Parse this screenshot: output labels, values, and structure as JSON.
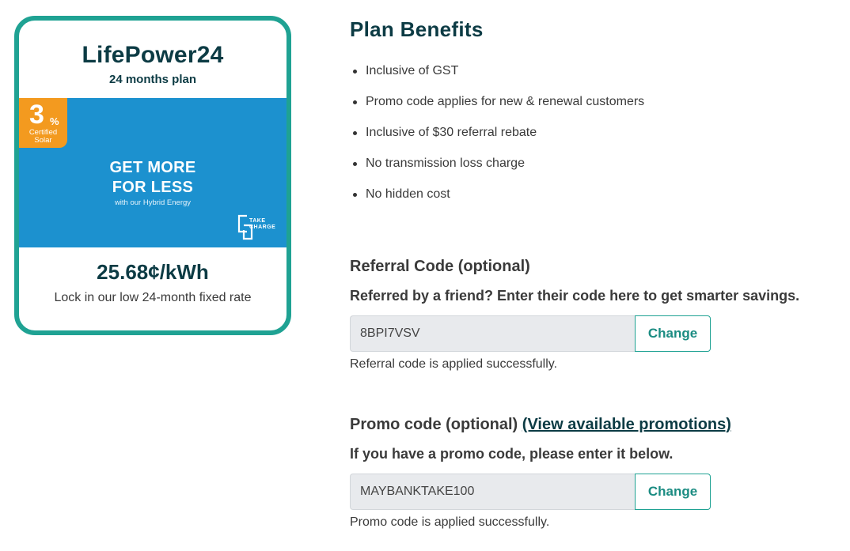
{
  "plan_card": {
    "name": "LifePower24",
    "term": "24 months plan",
    "banner": {
      "badge_number": "3",
      "badge_percent": "%",
      "badge_text_line1": "Certified",
      "badge_text_line2": "Solar",
      "headline_line1": "GET MORE",
      "headline_line2": "FOR LESS",
      "subline": "with our Hybrid Energy",
      "logo_line1": "TAKE",
      "logo_line2": "CHARGE"
    },
    "rate": "25.68¢/kWh",
    "rate_description": "Lock in our low 24-month fixed rate"
  },
  "benefits": {
    "title": "Plan Benefits",
    "items": [
      "Inclusive of GST",
      "Promo code applies for new & renewal customers",
      "Inclusive of $30 referral rebate",
      "No transmission loss charge",
      "No hidden cost"
    ]
  },
  "referral": {
    "title": "Referral Code (optional)",
    "subtitle": "Referred by a friend? Enter their code here to get smarter savings.",
    "value": "8BPI7VSV",
    "button_label": "Change",
    "status": "Referral code is applied successfully."
  },
  "promo": {
    "title": "Promo code (optional)",
    "link_label": "(View available promotions)",
    "subtitle": "If you have a promo code, please enter it below.",
    "value": "MAYBANKTAKE100",
    "button_label": "Change",
    "status": "Promo code is applied successfully."
  },
  "colors": {
    "accent_teal": "#1fa293",
    "dark_heading": "#0c3b44",
    "banner_blue": "#1c91cf",
    "badge_orange": "#f39a1f"
  }
}
